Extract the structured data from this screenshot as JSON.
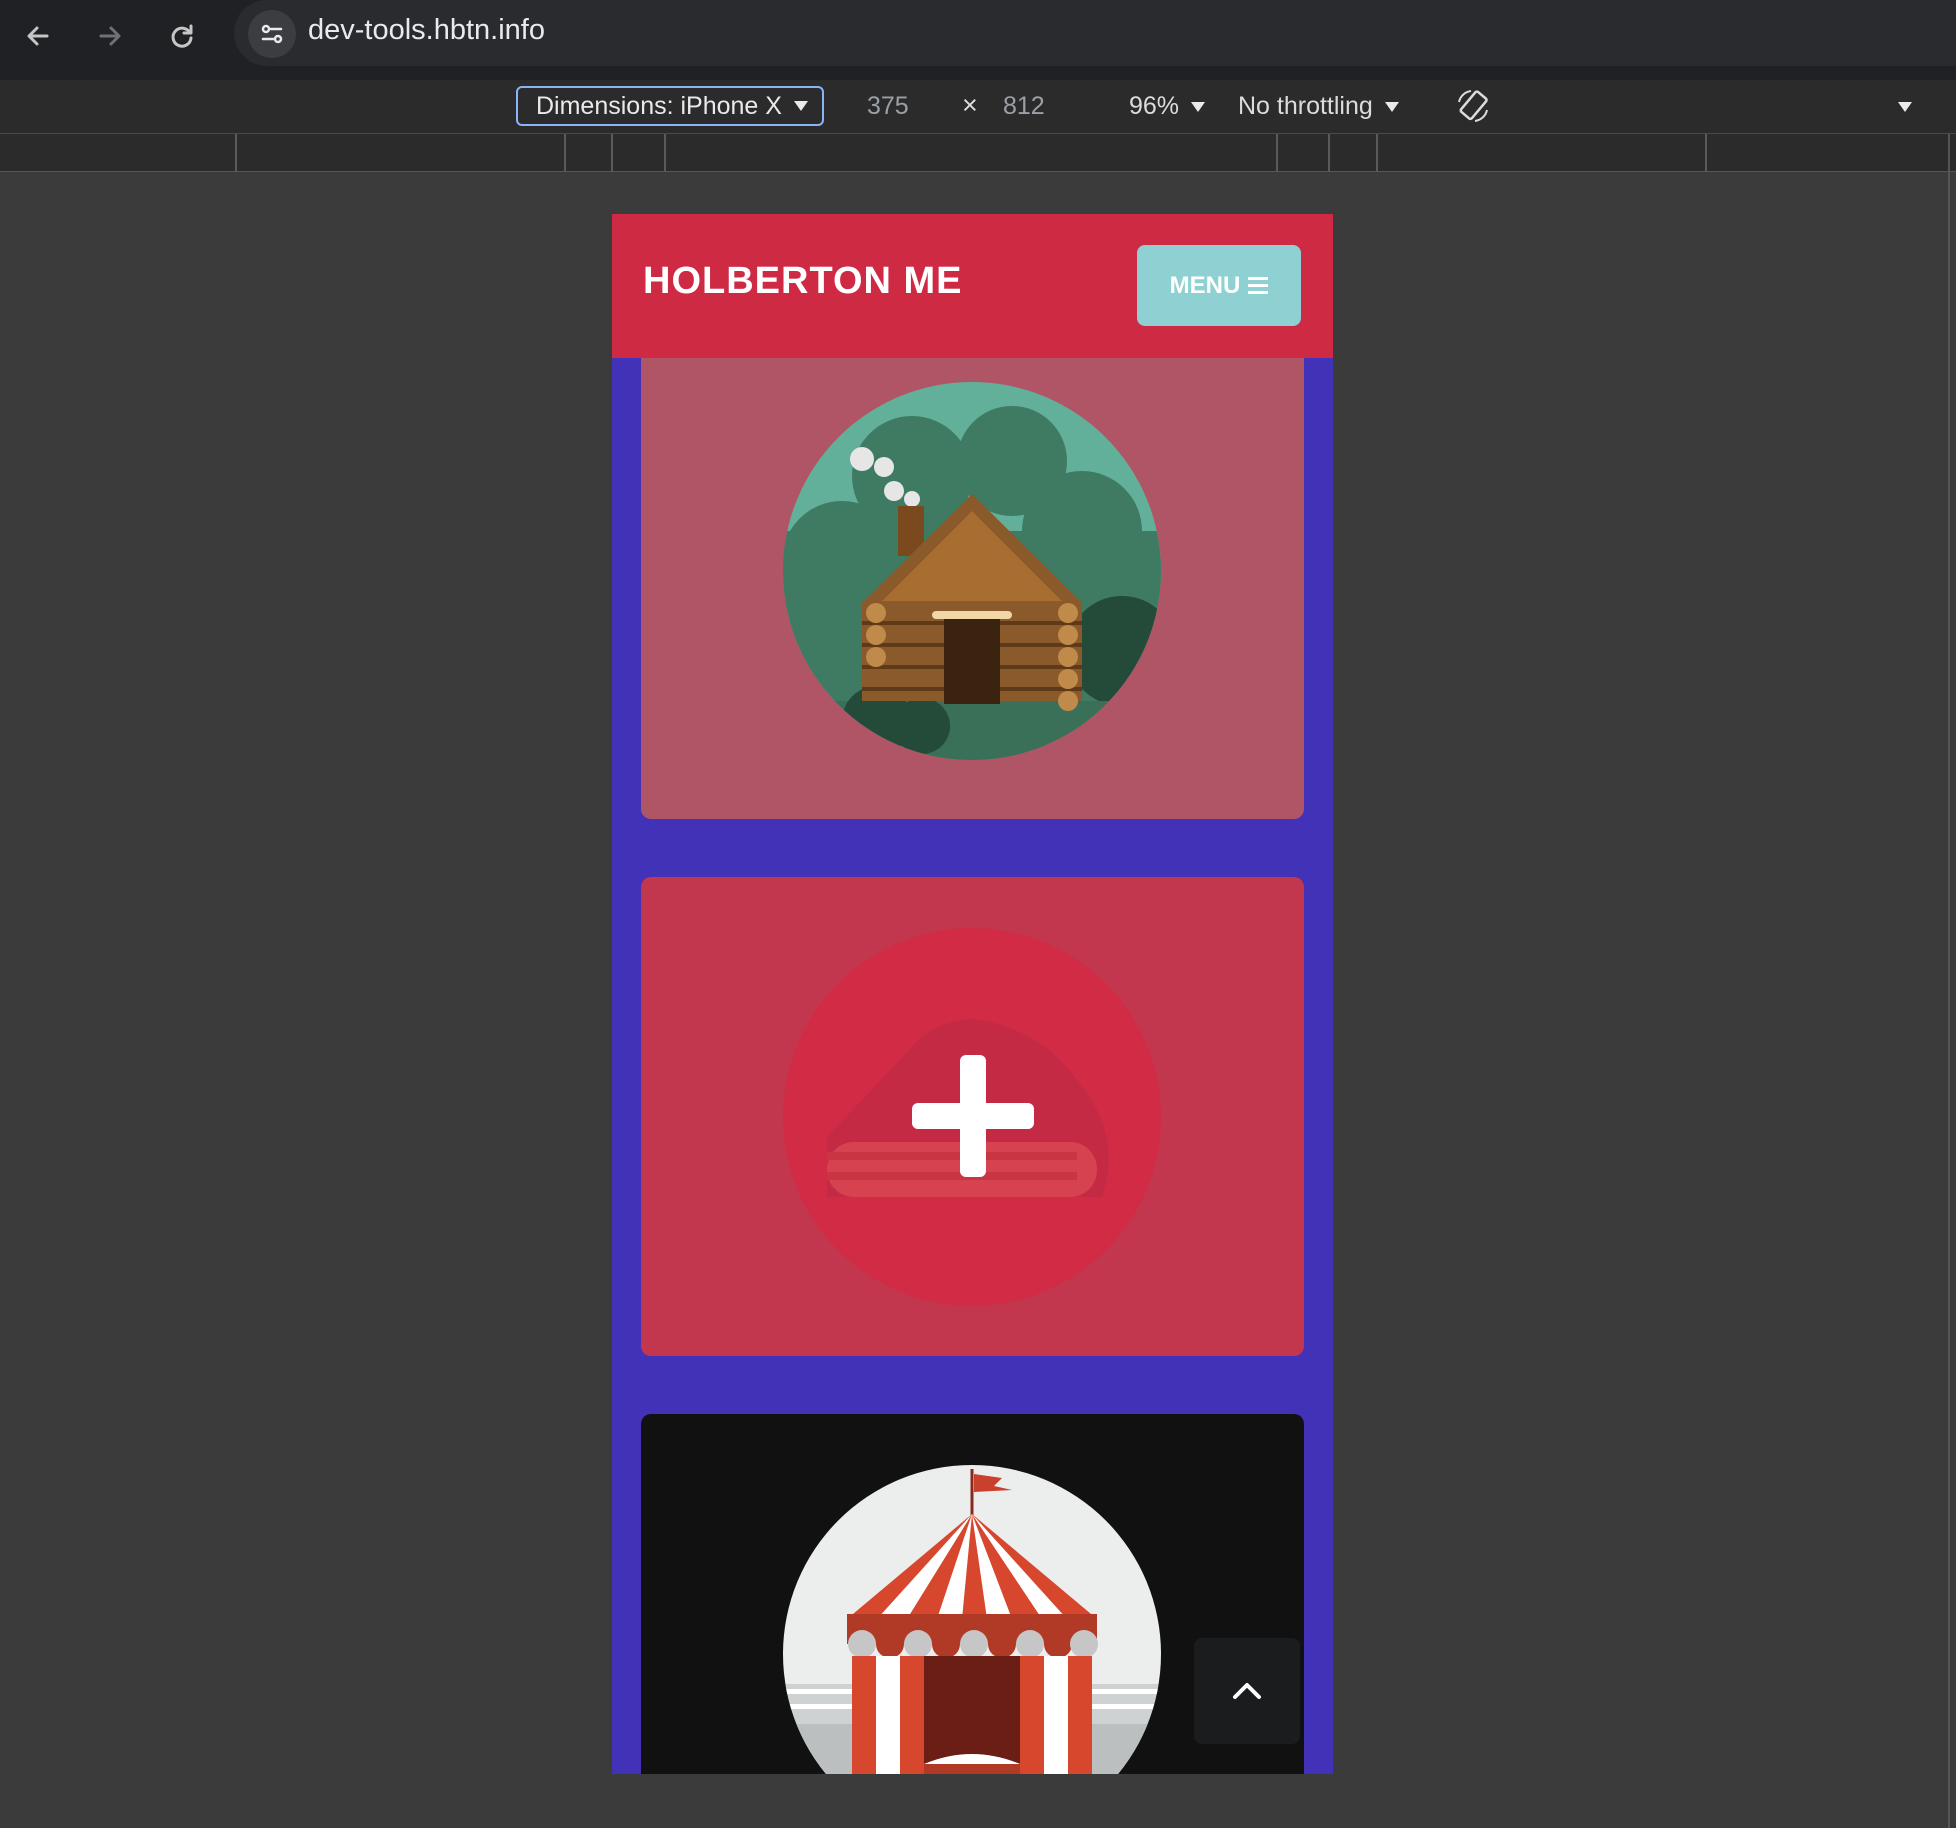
{
  "browser": {
    "url": "dev-tools.hbtn.info",
    "icons": [
      "back-arrow-icon",
      "forward-arrow-icon",
      "reload-icon",
      "site-settings-icon"
    ]
  },
  "device_toolbar": {
    "dimensions_label": "Dimensions: iPhone X",
    "width": "375",
    "times": "×",
    "height": "812",
    "zoom": "96%",
    "throttling": "No throttling"
  },
  "site": {
    "title": "HOLBERTON ME",
    "menu_label": "MENU",
    "colors": {
      "header": "#cf2a44",
      "background": "#4232b8",
      "menu_button": "#8fd0d3",
      "card_cabin": "#b05565",
      "card_first_aid": "#c2364e",
      "card_circus": "#111111"
    },
    "cards": [
      {
        "icon": "log-cabin-illustration"
      },
      {
        "icon": "first-aid-plus-illustration"
      },
      {
        "icon": "circus-tent-illustration"
      }
    ]
  }
}
